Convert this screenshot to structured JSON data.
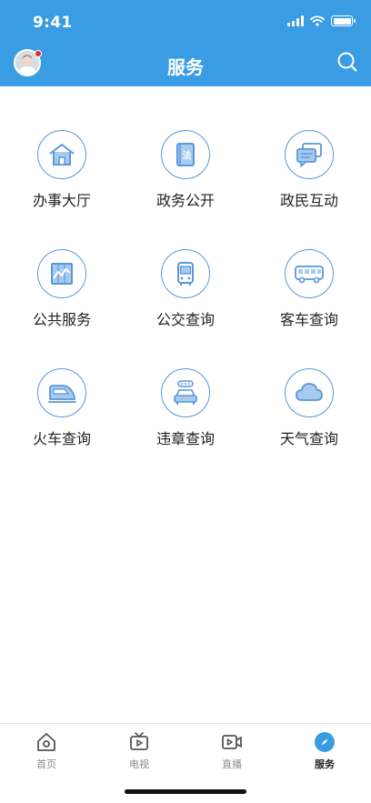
{
  "status_bar": {
    "time": "9:41"
  },
  "header": {
    "title": "服务"
  },
  "services": [
    {
      "label": "办事大厅",
      "icon": "office-hall-icon"
    },
    {
      "label": "政务公开",
      "icon": "law-book-icon"
    },
    {
      "label": "政民互动",
      "icon": "chat-bubbles-icon"
    },
    {
      "label": "公共服务",
      "icon": "trend-chart-icon"
    },
    {
      "label": "公交查询",
      "icon": "bus-front-icon"
    },
    {
      "label": "客车查询",
      "icon": "coach-bus-icon"
    },
    {
      "label": "火车查询",
      "icon": "high-speed-train-icon"
    },
    {
      "label": "违章查询",
      "icon": "car-traffic-light-icon"
    },
    {
      "label": "天气查询",
      "icon": "cloud-icon"
    }
  ],
  "tabbar": {
    "items": [
      {
        "label": "首页",
        "icon": "home-icon",
        "active": false
      },
      {
        "label": "电视",
        "icon": "tv-icon",
        "active": false
      },
      {
        "label": "直播",
        "icon": "live-video-icon",
        "active": false
      },
      {
        "label": "服务",
        "icon": "compass-icon",
        "active": true
      }
    ]
  },
  "colors": {
    "header": "#3a9de4",
    "icon_stroke": "#5a97d8",
    "icon_fill": "#a7cbef",
    "active_tab": "#3a9de4"
  }
}
